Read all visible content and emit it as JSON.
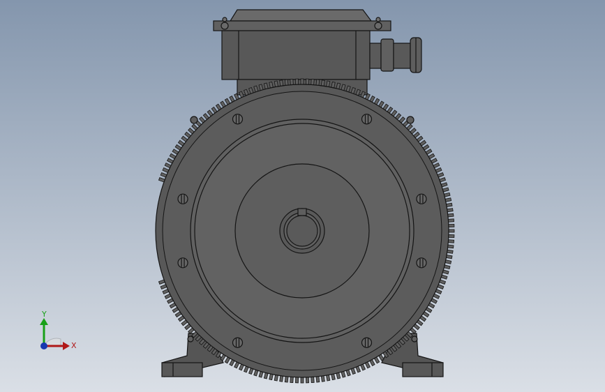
{
  "viewport": {
    "background_top": "#8496ad",
    "background_bottom": "#dadfe6",
    "model_color": "#5a5a5a",
    "edge_color": "#141414"
  },
  "triad": {
    "x_label": "X",
    "y_label": "Y",
    "x_color": "#b01818",
    "y_color": "#18a018",
    "z_color": "#1838b0"
  }
}
